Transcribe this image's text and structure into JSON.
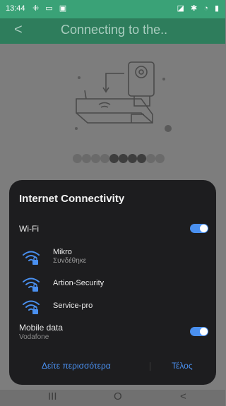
{
  "status_bar": {
    "time": "13:44"
  },
  "header": {
    "back_icon": "chevron-left",
    "title": "Connecting to the.."
  },
  "illustration": {
    "progress_dots_total": 10,
    "progress_dots_active": [
      5,
      6,
      7,
      8
    ]
  },
  "panel": {
    "heading": "Internet Connectivity",
    "wifi": {
      "label": "Wi-Fi",
      "enabled": true
    },
    "networks": [
      {
        "name": "Mikro",
        "status": "Συνδέθηκε"
      },
      {
        "name": "Artion-Security",
        "status": ""
      },
      {
        "name": "Service-pro",
        "status": ""
      }
    ],
    "mobile_data": {
      "label": "Mobile data",
      "carrier": "Vodafone",
      "enabled": true
    },
    "actions": {
      "more": "Δείτε περισσότερα",
      "done": "Τέλος"
    },
    "accent_color": "#4a90f0"
  },
  "nav_bar": {
    "recent": "III",
    "home": "O",
    "back": "<"
  }
}
